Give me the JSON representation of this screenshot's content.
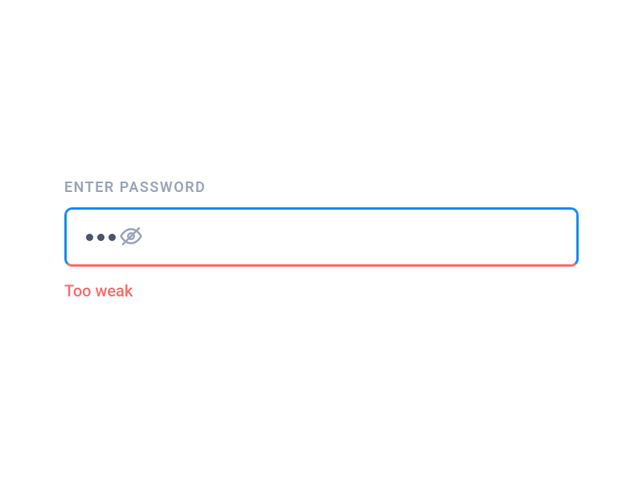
{
  "password_field": {
    "label": "ENTER PASSWORD",
    "value": "•••",
    "masked": true,
    "dot_count": 3
  },
  "strength": {
    "message": "Too weak",
    "level": "weak"
  },
  "colors": {
    "focus_border": "#1a8cff",
    "weak": "#ff6b6b",
    "label": "#9aa5b8",
    "dot": "#4a5568"
  },
  "icons": {
    "toggle_visibility": "eye-off-icon"
  }
}
